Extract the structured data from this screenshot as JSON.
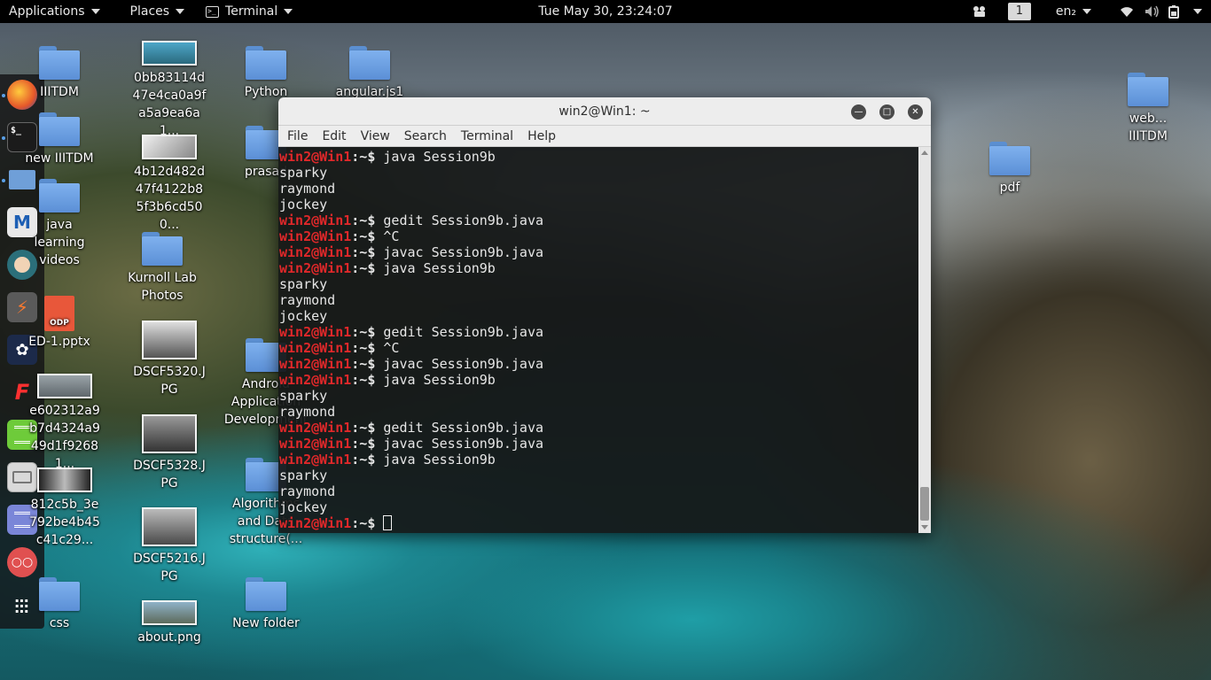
{
  "topbar": {
    "applications": "Applications",
    "places": "Places",
    "terminal": "Terminal",
    "clock": "Tue May 30, 23:24:07",
    "workspace": "1",
    "keyboard": "en₂"
  },
  "dock": {
    "items": [
      "firefox",
      "terminal",
      "files",
      "metasploit",
      "avatar-app",
      "burpsuite",
      "appearance",
      "faraday",
      "leafpad",
      "radio",
      "text-editor",
      "reader",
      "show-apps"
    ]
  },
  "desktop": {
    "icons": [
      {
        "label": "IIITDM"
      },
      {
        "label": "new IIITDM"
      },
      {
        "label": "java learning videos"
      },
      {
        "label": "ED-1.pptx"
      },
      {
        "label": "e602312a9b7d4324a949d1f92681..."
      },
      {
        "label": "812c5b_3e792be4b45c41c29..."
      },
      {
        "label": "css"
      },
      {
        "label": "0bb83114d47e4ca0a9fa5a9ea6a1..."
      },
      {
        "label": "4b12d482d47f4122b85f3b6cd500..."
      },
      {
        "label": "Kurnoll Lab Photos"
      },
      {
        "label": "DSCF5320.JPG"
      },
      {
        "label": "DSCF5328.JPG"
      },
      {
        "label": "DSCF5216.JPG"
      },
      {
        "label": "about.png"
      },
      {
        "label": "Python"
      },
      {
        "label": "prasad"
      },
      {
        "label": "Android Application Development"
      },
      {
        "label": "Algorithms and Data structure(..."
      },
      {
        "label": "New folder"
      },
      {
        "label": "angular.js1"
      },
      {
        "label": "web... IIITDM"
      },
      {
        "label": "pdf"
      }
    ]
  },
  "terminal": {
    "title": "win2@Win1: ~",
    "menu": [
      "File",
      "Edit",
      "View",
      "Search",
      "Terminal",
      "Help"
    ],
    "prompt_user": "win2@Win1",
    "prompt_dir": ":~$ ",
    "lines": [
      {
        "cmd": "java Session9b"
      },
      {
        "out": "sparky"
      },
      {
        "out": "raymond"
      },
      {
        "out": "jockey"
      },
      {
        "cmd": "gedit Session9b.java"
      },
      {
        "cmd": "^C"
      },
      {
        "cmd": "javac Session9b.java"
      },
      {
        "cmd": "java Session9b"
      },
      {
        "out": "sparky"
      },
      {
        "out": "raymond"
      },
      {
        "out": "jockey"
      },
      {
        "cmd": "gedit Session9b.java"
      },
      {
        "cmd": "^C"
      },
      {
        "cmd": "javac Session9b.java"
      },
      {
        "cmd": "java Session9b"
      },
      {
        "out": "sparky"
      },
      {
        "out": "raymond"
      },
      {
        "cmd": "gedit Session9b.java"
      },
      {
        "cmd": "javac Session9b.java"
      },
      {
        "cmd": "java Session9b"
      },
      {
        "out": "sparky"
      },
      {
        "out": "raymond"
      },
      {
        "out": "jockey"
      },
      {
        "cmd": ""
      }
    ]
  }
}
